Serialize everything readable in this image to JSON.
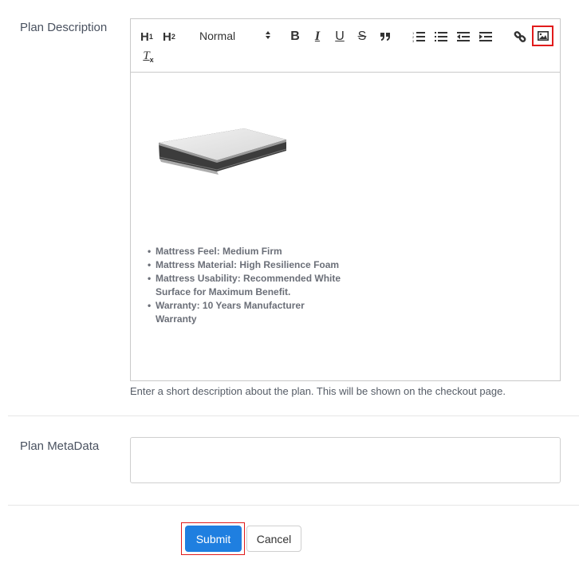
{
  "form": {
    "description_label": "Plan Description",
    "metadata_label": "Plan MetaData",
    "description_help": "Enter a short description about the plan. This will be shown on the checkout page.",
    "metadata_value": ""
  },
  "toolbar": {
    "h1": "H",
    "h1_sub": "1",
    "h2": "H",
    "h2_sub": "2",
    "format_select": "Normal",
    "buttons": [
      "header-1",
      "header-2",
      "format-select",
      "bold",
      "italic",
      "underline",
      "strike",
      "blockquote",
      "ordered-list",
      "bullet-list",
      "outdent",
      "indent",
      "link",
      "image",
      "clean-format"
    ],
    "bold": "B",
    "italic": "I",
    "underline": "U",
    "strike": "S",
    "quote": "❞",
    "highlighted_button": "image",
    "highlight_color": "#e11b1b"
  },
  "editor": {
    "image_alt": "Mattress",
    "features": [
      "Mattress Feel: Medium Firm",
      "Mattress Material: High Resilience Foam",
      "Mattress Usability: Recommended White Surface for Maximum Benefit.",
      "Warranty: 10 Years Manufacturer Warranty"
    ]
  },
  "actions": {
    "submit_label": "Submit",
    "cancel_label": "Cancel",
    "submit_color": "#1f7fe0",
    "submit_highlighted": true
  }
}
